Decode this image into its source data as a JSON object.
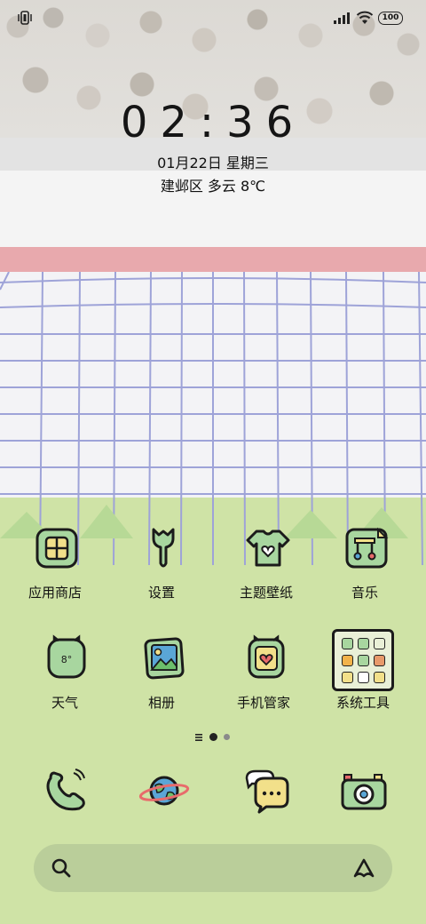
{
  "status_bar": {
    "battery": "100"
  },
  "lock": {
    "time": "02:36",
    "date": "01月22日 星期三",
    "weather": "建邺区 多云 8℃"
  },
  "apps_row1": [
    {
      "label": "应用商店",
      "icon": "app-store-icon"
    },
    {
      "label": "设置",
      "icon": "settings-wrench-icon"
    },
    {
      "label": "主题壁纸",
      "icon": "theme-shirt-icon"
    },
    {
      "label": "音乐",
      "icon": "music-icon"
    }
  ],
  "apps_row2": [
    {
      "label": "天气",
      "icon": "weather-icon",
      "badge": "8°"
    },
    {
      "label": "相册",
      "icon": "gallery-icon"
    },
    {
      "label": "手机管家",
      "icon": "phone-manager-icon"
    },
    {
      "label": "系统工具",
      "icon": "system-tools-folder-icon"
    }
  ],
  "dock": [
    {
      "icon": "phone-icon"
    },
    {
      "icon": "browser-planet-icon"
    },
    {
      "icon": "messages-icon"
    },
    {
      "icon": "camera-icon"
    }
  ],
  "colors": {
    "accent_green": "#a8d69f",
    "icon_yellow": "#f2e08a",
    "pink_band": "#e8a9ad",
    "net_line": "#9ea3d8",
    "grass": "#cfe3a6"
  }
}
